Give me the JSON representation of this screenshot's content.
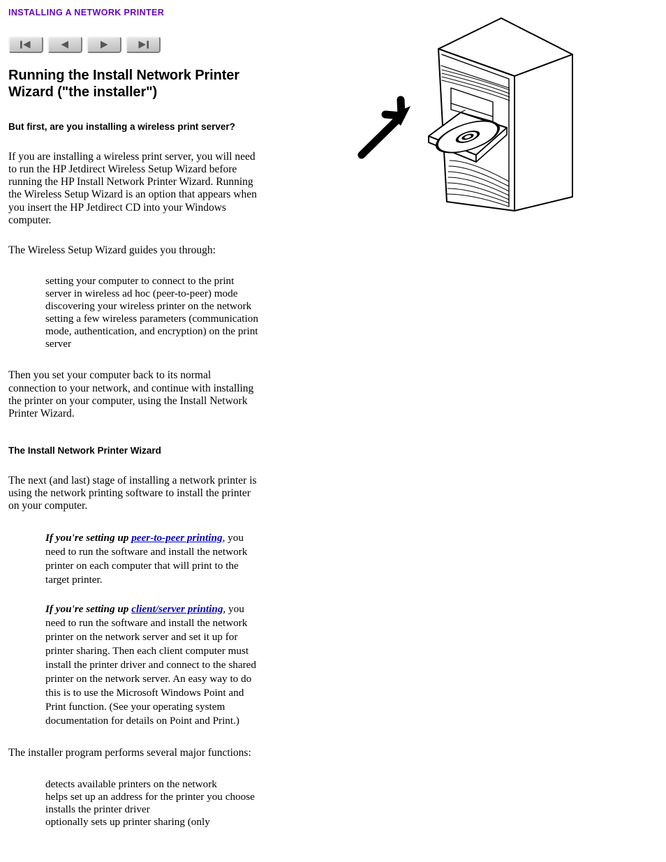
{
  "header": {
    "breadcrumb_title": "INSTALLING A NETWORK PRINTER",
    "accent_color": "#6600CC"
  },
  "navbar": {
    "buttons": [
      {
        "name": "first-page",
        "icon": "skip-to-start-icon",
        "label": "First page"
      },
      {
        "name": "previous-page",
        "icon": "play-back-icon",
        "label": "Previous page"
      },
      {
        "name": "next-page",
        "icon": "play-forward-icon",
        "label": "Next page"
      },
      {
        "name": "last-page",
        "icon": "skip-to-end-icon",
        "label": "Last page"
      }
    ]
  },
  "main": {
    "title": "Running the Install Network Printer Wizard (\"the installer\")",
    "wireless_heading": "But first, are you installing a wireless print server?",
    "wireless_paragraph": "If you are installing a wireless print server, you will need to run the HP Jetdirect Wireless Setup Wizard before running the HP Install Network Printer Wizard. Running the Wireless Setup Wizard is an option that appears when you insert the HP Jetdirect CD into your Windows computer.",
    "wizard_guides_intro": "The Wireless Setup Wizard guides you through:",
    "wizard_guides_items": [
      "setting your computer to connect to the print server in wireless ad hoc (peer-to-peer) mode",
      "discovering your wireless printer on the network",
      "setting a few wireless parameters (communication mode, authentication, and encryption) on the print server"
    ],
    "after_wizard_paragraph": "Then you set your computer back to its normal connection to your network, and continue with installing the printer on your computer, using the Install Network Printer Wizard.",
    "installer_heading": "The Install Network Printer Wizard",
    "installer_intro": "The next (and last) stage of installing a network printer is using the network printing software to install the printer on your computer.",
    "peer_to_peer": {
      "lead_in": "If you're setting up ",
      "link_text": "peer-to-peer printing",
      "link_color": "#0000CC",
      "rest": ", you need to run the software and install the network printer on each computer that will print to the target printer."
    },
    "client_server": {
      "lead_in": "If you're setting up ",
      "link_text": "client/server printing",
      "link_color": "#0000CC",
      "rest": ", you need to run the software and install the network printer on the network server and set it up for printer sharing. Then each client computer must install the printer driver and connect to the shared printer on the network server. An easy way to do this is to use the Microsoft Windows Point and Print function. (See your operating system documentation for details on Point and Print.)"
    },
    "functions_intro": "The installer program performs several major functions:",
    "functions_items": [
      "detects available printers on the network",
      "helps set up an address for the printer you choose",
      "installs the printer driver",
      "optionally sets up printer sharing (only"
    ]
  },
  "illustration": {
    "name": "computer-tower-with-cd-tray-illustration",
    "alt": "Line drawing of a desktop computer tower with the CD tray open, an arrow pointing at the tray",
    "stroke_color": "#000000",
    "fill_color": "#FFFFFF"
  }
}
